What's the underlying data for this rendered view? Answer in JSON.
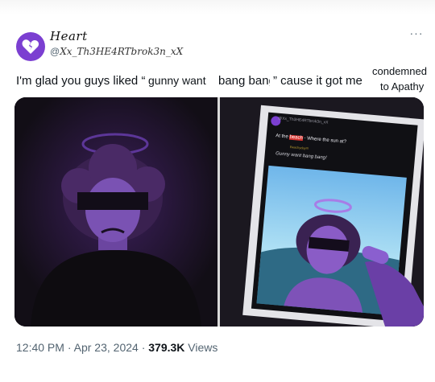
{
  "post": {
    "display_name": "Heart",
    "handle_prefix": "@",
    "handle": "Xx_Th3HE4RTbrok3n_xX",
    "more_label": "···",
    "avatar_icon": "broken-heart-icon",
    "avatar_color": "#7b3fd1"
  },
  "tweet": {
    "text_a": "I'm glad you guys liked “",
    "insert_1": "gunny want",
    "insert_2": "bang bang",
    "text_b": "” cause it got me",
    "insert_3": "condemned",
    "insert_4": "to Apathy"
  },
  "photo_card": {
    "handle": "@Xx_Th3HE4RTbrok3n_xX",
    "line_1_prefix": "At the ",
    "line_1_highlight": "beach",
    "line_1_suffix": " - Where the sun at?",
    "line_1_sub": "Beachyday!!!",
    "line_2": "Gunny want bang bang!"
  },
  "footer": {
    "time": "12:40 PM",
    "sep": "·",
    "date": "Apr 23, 2024",
    "views_count": "379.3K",
    "views_label": "Views"
  }
}
